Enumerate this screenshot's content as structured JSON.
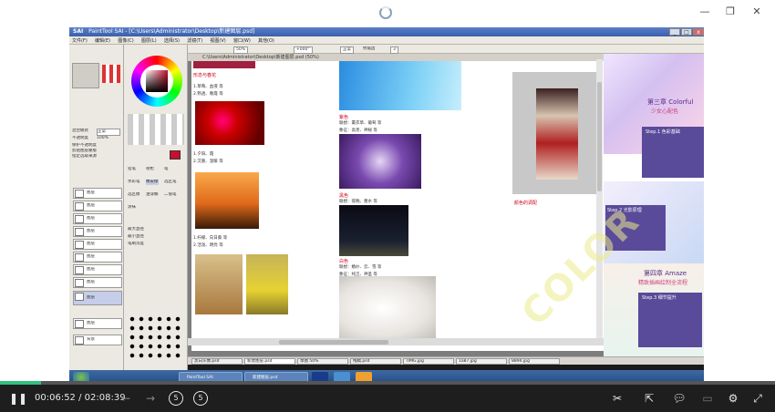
{
  "window": {
    "min_icon": "minimize-icon",
    "max_icon": "maximize-icon",
    "close_icon": "close-icon"
  },
  "app": {
    "title": "PaintTool SAI - [C:\\Users\\Administrator\\Desktop\\新建图层.psd]",
    "logo": "SAI",
    "menu": [
      "文件(F)",
      "编辑(E)",
      "图像(C)",
      "图层(L)",
      "选择(S)",
      "滤镜(T)",
      "视图(V)",
      "窗口(W)",
      "其他(O)"
    ],
    "toolbar": {
      "zoom": "50%",
      "angle": "+000°",
      "mode": "正常",
      "antialias": "抗锯齿",
      "stabilizer": "3"
    },
    "left": {
      "blend_label": "混合模式",
      "blend_value": "正常",
      "opacity_label": "不透明度",
      "opacity_value": "100%",
      "options": [
        "保护不透明度",
        "剪贴图层蒙版",
        "指定选取来源"
      ],
      "layers": [
        "图层",
        "图层",
        "图层",
        "图层",
        "图层",
        "图层",
        "图层",
        "图层",
        "图层",
        "图层",
        "背景"
      ]
    },
    "mid": {
      "tools": [
        "铅笔",
        "喷枪",
        "笔",
        "水彩笔",
        "橡皮擦",
        "选区笔",
        "选区擦",
        "油漆桶",
        "二值笔",
        "涂抹"
      ],
      "size_label": "最大直径",
      "min_label": "最小直径",
      "density_label": "笔刷浓度",
      "sizes": [
        "0.7",
        "0.8",
        "1",
        "1.5",
        "2",
        "2.3",
        "2.6",
        "3",
        "3.5",
        "4",
        "5",
        "6"
      ]
    },
    "canvas_title": "C:\\Users\\Administrator\\Desktop\\新建图层.psd (50%)",
    "document": {
      "heading1": "形态与春花",
      "text1": [
        "1.草莓、血液 等",
        "2.熟透、晚霞 等"
      ],
      "text2": [
        "1.夕阳、霞",
        "2.沉重、温暖 等"
      ],
      "text3": [
        "1.柠檬、向日葵 等",
        "2.活泼、明亮 等"
      ],
      "heading2": "紫色",
      "text4": [
        "联想：薰衣草、葡萄 等",
        "象征：高贵、神秘 等"
      ],
      "heading3": "黑色",
      "text5": [
        "联想：夜晚、墨水 等"
      ],
      "heading4": "白色",
      "text6": [
        "联想：婚纱、云、雪 等",
        "象征：纯洁、神圣 等"
      ],
      "caption": "颜色的调配"
    },
    "side": {
      "chapter3": "第三章 Colorful",
      "chapter3_sub": "少女心配色",
      "step1": "Step.1 色彩基础",
      "step2": "Step.2 光影原理",
      "chapter4": "第四章 Amaze",
      "chapter4_sub": "精致插画绘制全流程",
      "step3": "Step.3 细节提升"
    },
    "tabs": [
      "黑白头像.psd",
      "新建图层.psd",
      "草图 50%",
      "线稿.psd",
      "TIMG.jpg",
      "1a87.jpg",
      "8894.jpg"
    ],
    "taskbar": {
      "window1": "PaintTool SAI",
      "window2": "新建图层.psd"
    }
  },
  "watermark": "COLOR",
  "player": {
    "current": "00:06:52",
    "separator": "/",
    "duration": "02:08:39",
    "progress": 0.053,
    "back_label": "5",
    "fwd_label": "5"
  }
}
